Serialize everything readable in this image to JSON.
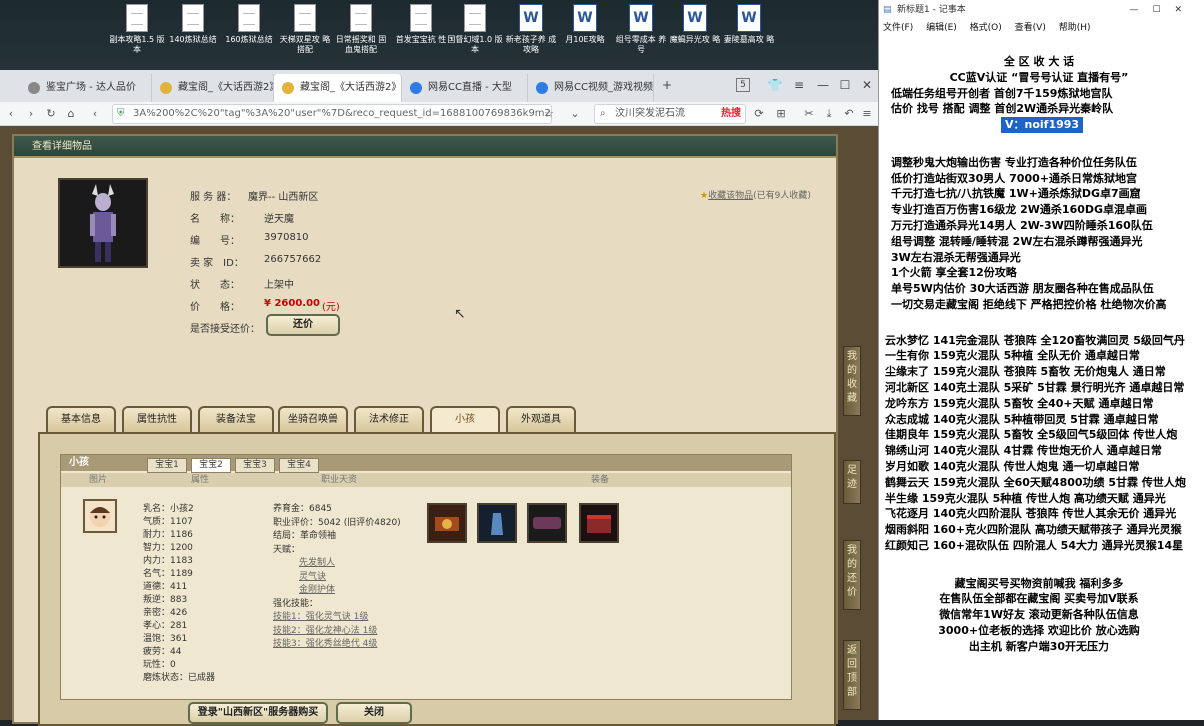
{
  "desktop_icons": [
    "副本攻略1.5 版本",
    "140炼狱总结",
    "160炼狱总结",
    "天梯双星攻 略搭配",
    "日常摇奖和 固血鬼搭配",
    "首发宝宝抗 性",
    "国督幻域1.0 版本",
    "新老孩子养 成攻略",
    "月10E攻略",
    "组号零成本 养号",
    "魔蝎异光攻 略",
    "妻陵墓高攻 略"
  ],
  "browser": {
    "tabs": [
      "鉴宝广场 - 达人品价",
      "藏宝阁_《大话西游2》",
      "藏宝阁_《大话西游2》",
      "网易CC直播 - 大型",
      "网易CC视频_游戏视频"
    ],
    "url": "3A%200%2C%20\"tag\"%3A%20\"user\"%7D&reco_request_id=1688100769836k9m2p",
    "search": "汶川突发泥石流",
    "hot": "热搜",
    "tab_count": "5"
  },
  "page": {
    "title": "查看详细物品",
    "server_label": "服 务 器：",
    "server": "魔界-- 山西新区",
    "name_label": "名　　称：",
    "name": "逆天魔",
    "num_label": "编　　号：",
    "num": "3970810",
    "seller_label": "卖 家　ID：",
    "seller": "266757662",
    "status_label": "状　　态：",
    "status": "上架中",
    "price_label": "价　　格：",
    "price": "¥ 2600.00",
    "price_unit": "(元)",
    "bargain_label": "是否接受还价：",
    "bargain_btn": "还价",
    "fav": "收藏该物品",
    "fav_count": "(已有9人收藏)",
    "tabs": [
      "基本信息",
      "属性抗性",
      "装备法宝",
      "坐骑召唤兽",
      "法术修正",
      "小孩",
      "外观道具"
    ],
    "child": {
      "head": "小孩",
      "subtabs": [
        "宝宝1",
        "宝宝2",
        "宝宝3",
        "宝宝4"
      ],
      "cols": [
        "图片",
        "属性",
        "职业天资",
        "装备"
      ],
      "attrs": [
        "乳名：小孩2",
        "气质：1107",
        "耐力：1186",
        "智力：1200",
        "内力：1183",
        "名气：1189",
        "道德：411",
        "叛逆：883",
        "亲密：426",
        "孝心：281",
        "温饱：361",
        "疲劳：44",
        "玩性：0",
        "磨炼状态：已成器"
      ],
      "prof": [
        "养育金：6845",
        "职业评价：5042 (旧评价4820)",
        "结局：革命领袖",
        "天赋：",
        "先发制人",
        "灵气诀",
        "金刚护体",
        "强化技能：",
        "技能1：强化灵气诀 1级",
        "技能2：强化龙神心法 1级",
        "技能3：强化秀丝绝代 4级"
      ]
    },
    "login_btn": "登录\"山西新区\"服务器购买",
    "close_btn": "关闭",
    "side": [
      "我的收藏",
      "足迹",
      "我的还价",
      "返回顶部"
    ]
  },
  "notepad": {
    "title": "新标题1 - 记事本",
    "menu": [
      "文件(F)",
      "编辑(E)",
      "格式(O)",
      "查看(V)",
      "帮助(H)"
    ],
    "lines": [
      "全 区 收 大 话",
      "CC蓝V认证 “冒号号认证 直播有号”",
      "低端任务组号开创者            首创7千159炼狱地宫队",
      "估价 找号 搭配 调整            首创2W通杀异光秦岭队",
      "V：noif1993",
      "",
      "调整秒鬼大炮输出伤害          专业打造各种价位任务队伍",
      "低价打造站街双30男人            7000+通杀日常炼狱地宫",
      "千元打造七抗/八抗铁魔          1W+通杀炼狱DG卓7画窟",
      "专业打造百万伤害16级龙         2W通杀160DG卓混卓画",
      "万元打造通杀异光14男人       2W-3W四阶睡杀160队伍",
      "组号调整 混转睡/睡转混          2W左右混杀蹲帮强通异光",
      "                                                3W左右混杀无帮强通异光",
      "1个火箭 享全套12份攻略",
      "单号5W内估价 30大话西游         朋友圈各种在售成品队伍",
      "一切交易走藏宝阁 拒绝线下     严格把控价格 杜绝物次价高",
      "",
      "云水梦忆 141完金混队 苍狼阵 全120畜牧满回灵 5级回气丹",
      "一生有你 159克火混队 5种植 全队无价 通卓越日常",
      "尘缘末了 159克火混队 苍狼阵 5畜牧 无价炮鬼人 通日常",
      "河北新区 140克土混队 5采矿 5甘霖 景行明光齐 通卓越日常",
      "龙吟东方 159克火混队 5畜牧 全40+天赋 通卓越日常",
      "众志成城 140克火混队 5种植带回灵 5甘霖 通卓越日常",
      "佳期良年 159克火混队 5畜牧 全5级回气5级回体 传世人炮",
      "锦绣山河 140克火混队 4甘霖 传世炮无价人 通卓越日常",
      "岁月如歌 140克火混队 传世人炮鬼 通一切卓越日常",
      "鹤舞云天 159克火混队 全60天赋4800功绩 5甘霖 传世人炮",
      "半生缘    159克火混队 5种植 传世人炮 高功绩天赋 通异光",
      "飞花逐月 140克火四阶混队 苍狼阵 传世人其余无价 通异光",
      "烟雨斜阳 160+克火四阶混队 高功绩天赋带孩子 通异光灵猴",
      "红颜知己 160+混砍队伍 四阶混人 54大力 通异光灵猴14星",
      "",
      "藏宝阁买号买物资前喊我 福利多多",
      "在售队伍全部都在藏宝阁 买卖号加V联系",
      "微信常年1W好友 滚动更新各种队伍信息",
      "3000+位老板的选择 欢迎比价 放心选购",
      "出主机 新客户端30开无压力"
    ]
  }
}
